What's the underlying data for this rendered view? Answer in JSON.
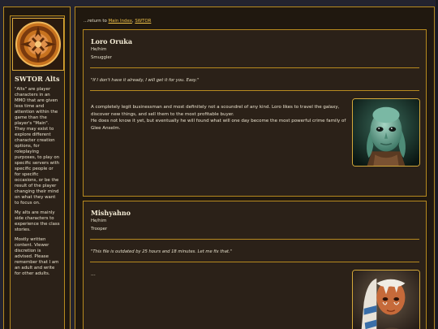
{
  "sidebar": {
    "title": "SWTOR Alts",
    "logo_icon": "old-republic-emblem-icon",
    "paragraphs": [
      "\"Alts\" are player characters in an MMO that are given less time and attention within the game than the player's \"Main\". They may exist to explore different character creation options, for roleplaying purposes, to play on specific servers with specific people or for specific occasions, or be the result of the player changing their mind on what they want to focus on.",
      "My alts are mainly side characters to experience the class stories.",
      "Mostly written content. Viewer discretion is advised. Please remember that I am an adult and write for other adults."
    ]
  },
  "breadcrumb": {
    "prefix": "...return to ",
    "link1": "Main Index",
    "separator": ", ",
    "link2": "SWTOR"
  },
  "characters": [
    {
      "name": "Loro Oruka",
      "pronouns": "He/him",
      "role": "Smuggler",
      "quote": "\"If I don't have it already, I will get it for you. Easy.\"",
      "bio": [
        "A completely legit businessman and most definitely not a scoundrel of any kind. Loro likes to travel the galaxy, discover new things, and sell them to the most profitable buyer.",
        "He does not know it yet, but eventually he will found what will one day become the most powerful crime family of Glee Anselm."
      ],
      "portrait_icon": "nautolan-portrait-image"
    },
    {
      "name": "Mishyahno",
      "pronouns": "He/him",
      "role": "Trooper",
      "quote": "\"This file is outdated by 25 hours and 18 minutes. Let me fix that.\"",
      "bio_placeholder": "...",
      "portrait_icon": "togruta-portrait-image"
    }
  ],
  "colors": {
    "background": "#23232f",
    "panel": "#20180f",
    "card": "#2b2118",
    "accent": "#b78a1f",
    "link": "#f0c24a"
  }
}
